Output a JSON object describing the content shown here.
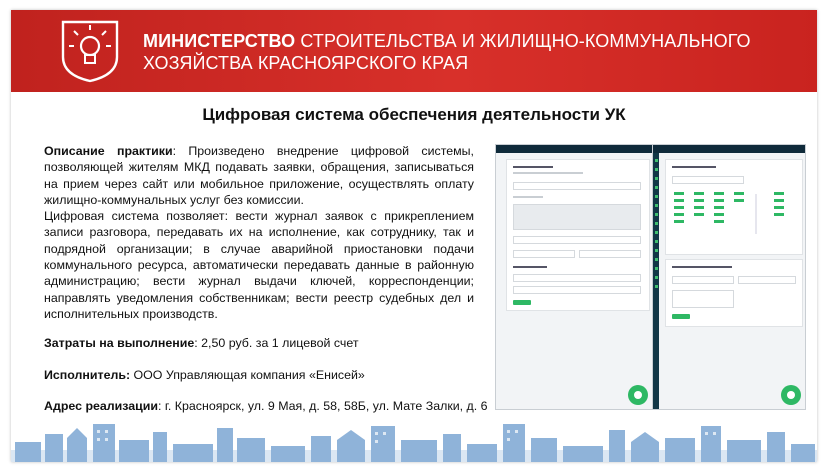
{
  "header": {
    "ministry_bold": "МИНИСТЕРСТВО",
    "ministry_rest": "СТРОИТЕЛЬСТВА И ЖИЛИЩНО-КОММУНАЛЬНОГО",
    "ministry_line2": "ХОЗЯЙСТВА КРАСНОЯРСКОГО КРАЯ"
  },
  "title": "Цифровая система обеспечения деятельности УК",
  "description": {
    "label": "Описание практики",
    "text1": ": Произведено внедрение цифровой системы, позволяющей жителям МКД подавать заявки, обращения, записываться на прием через сайт или мобильное приложение, осуществлять оплату жилищно-коммунальных услуг без комиссии.",
    "text2": "Цифровая система позволяет: вести журнал заявок с прикреплением записи разговора, передавать их на исполнение, как сотруднику, так и подрядной организации; в случае аварийной приостановки подачи коммунального ресурса, автоматически передавать данные в районную администрацию; вести журнал выдачи ключей, корреспонденции; направлять уведомления собственникам; вести реестр судебных дел и исполнительных производств."
  },
  "costs": {
    "label": "Затраты на выполнение",
    "value": ": 2,50 руб. за 1 лицевой счет"
  },
  "executor": {
    "label": "Исполнитель:",
    "value": " ООО Управляющая компания «Енисей»"
  },
  "address": {
    "label": "Адрес реализации",
    "value": ": г. Красноярск, ул. 9 Мая, д. 58, 58Б, ул. Мате Залки, д. 6"
  },
  "icons": {
    "emblem": "lightbulb-icon",
    "chat": "chat-icon"
  },
  "colors": {
    "brand_red": "#d02a25",
    "accent_green": "#2eb864",
    "dark_nav": "#0f2a3a"
  }
}
